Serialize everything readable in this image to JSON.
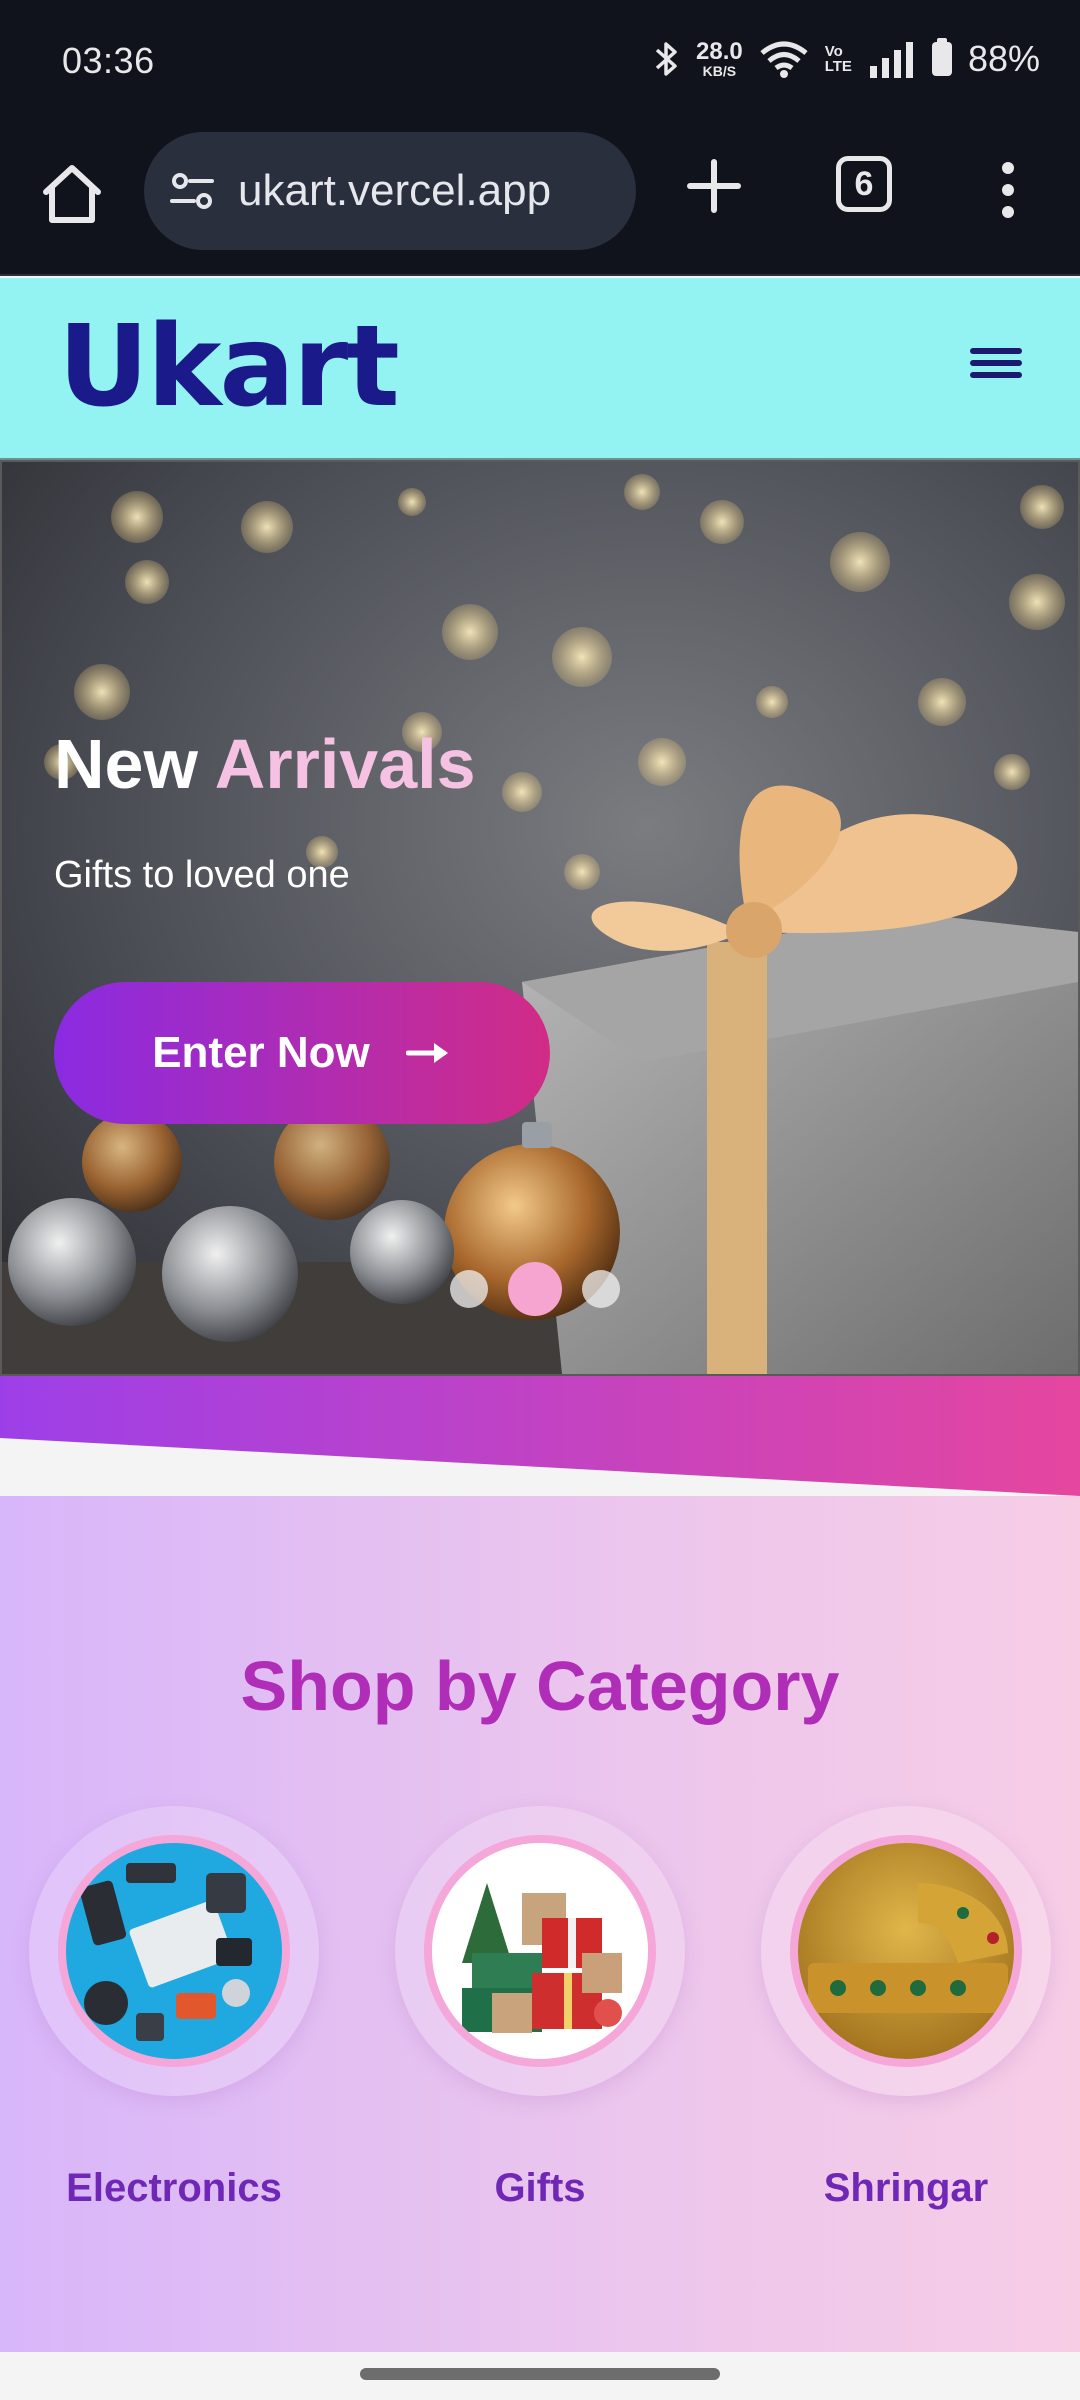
{
  "status_bar": {
    "time": "03:36",
    "net_speed": "28.0",
    "net_unit": "KB/S",
    "volte_top": "Vo",
    "volte_bottom": "LTE",
    "battery": "88%",
    "icons": [
      "bluetooth-icon",
      "wifi-icon",
      "signal-icon",
      "battery-icon"
    ]
  },
  "browser": {
    "url": "ukart.vercel.app",
    "tab_count": "6",
    "icons": [
      "home-icon",
      "site-settings-icon",
      "new-tab-icon",
      "tabs-icon",
      "more-menu-icon"
    ]
  },
  "site": {
    "logo": "Ukart",
    "colors": {
      "header_bg": "#93f2f2",
      "logo": "#1b1a8a",
      "accent": "#b02db7"
    }
  },
  "hero": {
    "title_main": "New",
    "title_accent": "Arrivals",
    "subtitle": "Gifts to loved one",
    "cta_label": "Enter Now",
    "cta_icon": "arrow-right-icon",
    "slides_total": 3,
    "active_slide": 2
  },
  "categories": {
    "title": "Shop by Category",
    "items": [
      {
        "label": "Electronics"
      },
      {
        "label": "Gifts"
      },
      {
        "label": "Shringar"
      }
    ]
  }
}
